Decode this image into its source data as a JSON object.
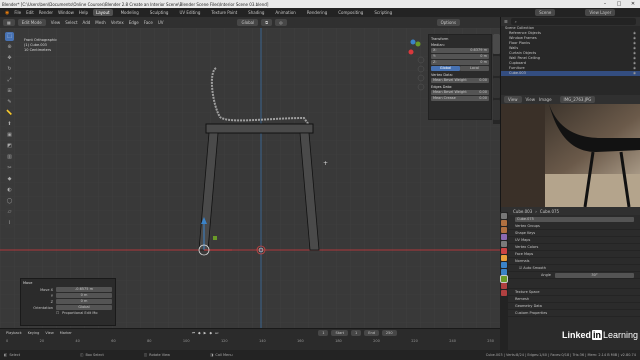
{
  "titlebar": {
    "title": "Blender* [C:\\Users\\ben\\Documents\\Online Courses\\Blender 2.8 Create an Interior Scene\\Blender Scene Files\\Interior Scene 03.blend]",
    "min": "–",
    "max": "□",
    "close": "✕"
  },
  "menubar": {
    "menus": [
      "File",
      "Edit",
      "Render",
      "Window",
      "Help"
    ],
    "workspaces": [
      "Layout",
      "Modeling",
      "Sculpting",
      "UV Editing",
      "Texture Paint",
      "Shading",
      "Animation",
      "Rendering",
      "Compositing",
      "Scripting"
    ],
    "active_workspace": "Layout",
    "scene": "Scene",
    "view_layer": "View Layer"
  },
  "header3d": {
    "mode": "Edit Mode",
    "menus": [
      "View",
      "Select",
      "Add",
      "Mesh",
      "Vertex",
      "Edge",
      "Face",
      "UV"
    ],
    "orientation": "Global",
    "options": "Options"
  },
  "viewport": {
    "view_name": "Front Orthographic",
    "object": "(1) Cube.003",
    "scale": "10 Centimeters",
    "colors": {
      "x_axis": "#d9383c",
      "y_axis": "#6a9a28",
      "z_axis": "#3b83c8",
      "bg": "#393939"
    }
  },
  "npanel": {
    "section": "Transform",
    "median_label": "Median:",
    "fields": [
      {
        "label": "X:",
        "value": "0.6379 m"
      },
      {
        "label": "Y:",
        "value": "0 m"
      },
      {
        "label": "Z:",
        "value": "0 m"
      }
    ],
    "global": "Global",
    "local": "Local",
    "vertex_data": "Vertex Data:",
    "vertex_bevel": "Mean Bevel Weight",
    "vertex_bevel_val": "0.00",
    "edge_data": "Edges Data:",
    "edge_bevel": "Mean Bevel Weight",
    "edge_bevel_val": "0.00",
    "crease": "Mean Crease",
    "crease_val": "0.00",
    "tabs": [
      "Item",
      "Tool",
      "View",
      "Screencast Keys",
      "Edit"
    ]
  },
  "op_popup": {
    "title": "Move",
    "fields": [
      {
        "label": "Move X",
        "value": "-0.6575 m"
      },
      {
        "label": "Y",
        "value": "0 m"
      },
      {
        "label": "Z",
        "value": "0 m"
      },
      {
        "label": "Orientation",
        "value": "Global"
      }
    ],
    "prop_edit": "Proportional Edit Mo"
  },
  "timeline": {
    "menus": [
      "Playback",
      "Keying",
      "View",
      "Marker"
    ],
    "ticks": [
      "0",
      "20",
      "40",
      "60",
      "80",
      "100",
      "120",
      "140",
      "160",
      "180",
      "200",
      "220",
      "240",
      "250"
    ],
    "current_frame": "1",
    "start_label": "Start",
    "start": "1",
    "end_label": "End",
    "end": "250"
  },
  "status": {
    "select": "Select",
    "box_select": "Box Select",
    "rotate_view": "Rotate View",
    "call_menu": "Call Menu",
    "stats": "Cube.003 | Verts:8/24 | Edges:1/40 | Faces:0/18 | Tris:36 | Mem: 2.14 B MiB | v2.80.74"
  },
  "outliner": {
    "header": "Scene Collection",
    "items": [
      {
        "name": "Reference Objects",
        "selected": false
      },
      {
        "name": "Window Frames",
        "selected": false
      },
      {
        "name": "Floor Planks",
        "selected": false
      },
      {
        "name": "Walls",
        "selected": false
      },
      {
        "name": "Curtain Objects",
        "selected": false
      },
      {
        "name": "Wall Panel Ceiling",
        "selected": false
      },
      {
        "name": "Cupboard",
        "selected": false
      },
      {
        "name": "Furniture",
        "selected": false
      },
      {
        "name": "Cube.003",
        "selected": true
      }
    ]
  },
  "image_editor": {
    "mode": "View",
    "menus": [
      "View",
      "Image"
    ],
    "image_name": "IMG_2763.JPG"
  },
  "properties": {
    "object": "Cube.003",
    "mesh": "Cube.075",
    "data_name": "Cube.075",
    "panels": [
      "Vertex Groups",
      "Shape Keys",
      "UV Maps",
      "Vertex Colors",
      "Face Maps",
      "Normals",
      "Texture Space",
      "Remesh",
      "Geometry Data",
      "Custom Properties"
    ],
    "auto_smooth": "Auto Smooth",
    "angle_label": "Angle",
    "angle": "30°"
  },
  "watermark": {
    "brand": "Linked",
    "in": "in",
    "suffix": "Learning"
  }
}
